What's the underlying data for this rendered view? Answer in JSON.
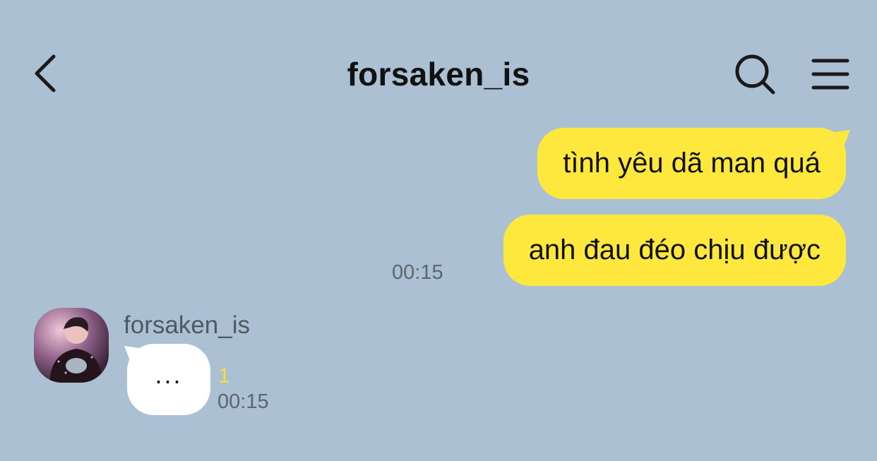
{
  "header": {
    "title": "forsaken_is",
    "back_icon": "chevron-left-icon",
    "search_icon": "search-icon",
    "menu_icon": "menu-icon"
  },
  "messages_sent": [
    {
      "text": "tình yêu dã man quá"
    },
    {
      "text": "anh đau đéo chịu được",
      "time": "00:15"
    }
  ],
  "message_received": {
    "sender": "forsaken_is",
    "text": "...",
    "unread_count": "1",
    "time": "00:15"
  },
  "colors": {
    "background": "#abc1d3",
    "sent_bubble": "#fee83d",
    "received_bubble": "#ffffff",
    "unread": "#f7e03a"
  }
}
